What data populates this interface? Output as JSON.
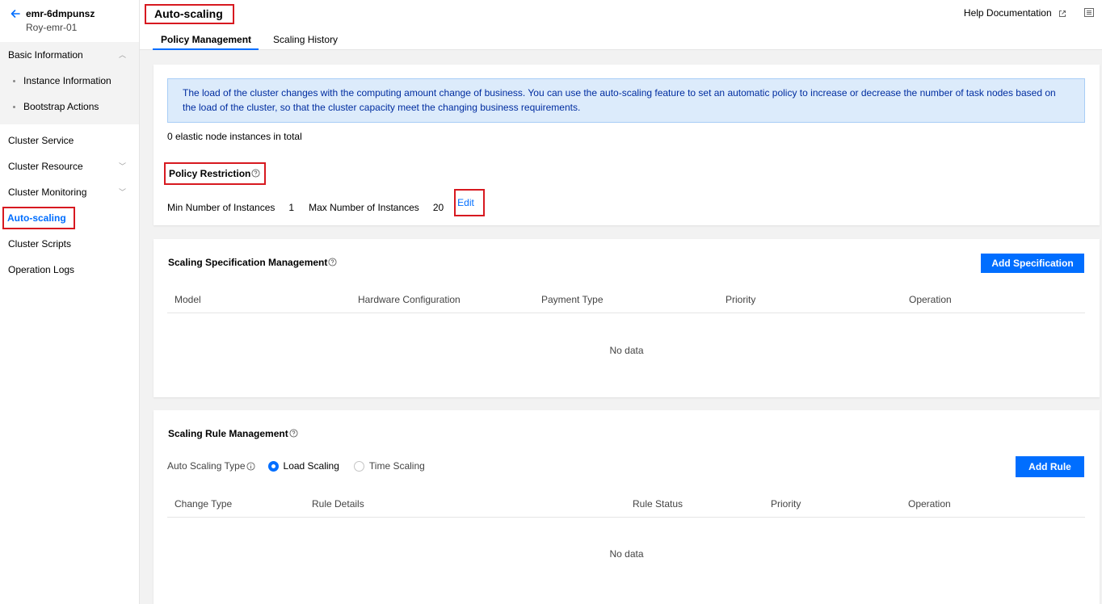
{
  "sidebar": {
    "instance_id": "emr-6dmpunsz",
    "instance_name": "Roy-emr-01",
    "basic_info": "Basic Information",
    "instance_information": "Instance Information",
    "bootstrap_actions": "Bootstrap Actions",
    "cluster_service": "Cluster Service",
    "cluster_resource": "Cluster Resource",
    "cluster_monitoring": "Cluster Monitoring",
    "auto_scaling": "Auto-scaling",
    "cluster_scripts": "Cluster Scripts",
    "operation_logs": "Operation Logs"
  },
  "header": {
    "title": "Auto-scaling",
    "help": "Help Documentation",
    "tabs": [
      {
        "label": "Policy Management",
        "active": true
      },
      {
        "label": "Scaling History",
        "active": false
      }
    ]
  },
  "policy": {
    "notice": "The load of the cluster changes with the computing amount change of business. You can use the auto-scaling feature to set an automatic policy to increase or decrease the number of task nodes based on the load of the cluster, so that the cluster capacity meet the changing business requirements.",
    "total": "0 elastic node instances in total",
    "restriction_title": "Policy Restriction",
    "min_label": "Min Number of Instances",
    "min_value": "1",
    "max_label": "Max Number of Instances",
    "max_value": "20",
    "edit": "Edit"
  },
  "spec": {
    "title": "Scaling Specification Management",
    "add_button": "Add Specification",
    "columns": [
      "Model",
      "Hardware Configuration",
      "Payment Type",
      "Priority",
      "Operation"
    ],
    "empty": "No data"
  },
  "rules": {
    "title": "Scaling Rule Management",
    "type_label": "Auto Scaling Type",
    "options": [
      "Load Scaling",
      "Time Scaling"
    ],
    "add_button": "Add Rule",
    "columns": [
      "Change Type",
      "Rule Details",
      "Rule Status",
      "Priority",
      "Operation"
    ],
    "empty": "No data"
  },
  "colors": {
    "accent": "#006eff",
    "highlight": "#d71920",
    "notice_bg": "#dcebfb"
  }
}
